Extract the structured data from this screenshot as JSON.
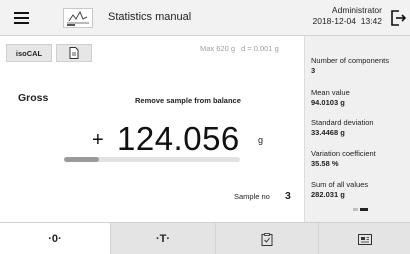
{
  "header": {
    "title": "Statistics manual",
    "user": "Administrator",
    "date": "2018-12-04",
    "time": "13:42",
    "icons": [
      "menu-icon",
      "statistics-mode-icon",
      "logout-icon"
    ]
  },
  "toolbar": {
    "isocal_label": "isoCAL",
    "doc_icon": "document-icon"
  },
  "balance": {
    "max": "Max 620 g",
    "readability": "d = 0.001 g",
    "mode": "Gross",
    "prompt": "Remove sample from balance",
    "sign": "+",
    "value": "124.056",
    "unit": "g",
    "capacity_used_percent": 20,
    "sample_label": "Sample no",
    "sample_no": "3"
  },
  "stats": [
    {
      "label": "Number of components",
      "value": "3"
    },
    {
      "label": "Mean value",
      "value": "94.0103 g"
    },
    {
      "label": "Standard deviation",
      "value": "33.4468 g"
    },
    {
      "label": "Variation coefficient",
      "value": "35.58 %"
    },
    {
      "label": "Sum of all values",
      "value": "282.031 g"
    }
  ],
  "softkeys": [
    {
      "label": "·0·",
      "icon": "zero-icon"
    },
    {
      "label": "·T·",
      "icon": "tare-icon"
    },
    {
      "label": "",
      "icon": "checklist-icon"
    },
    {
      "label": "",
      "icon": "print-icon"
    }
  ]
}
